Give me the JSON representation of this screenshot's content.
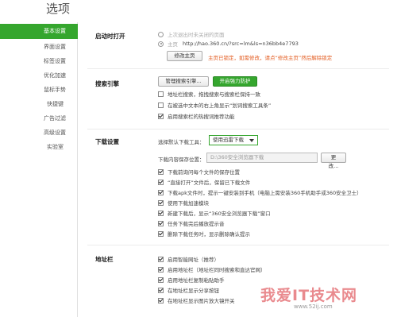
{
  "page": {
    "title": "选项"
  },
  "sidebar": {
    "items": [
      {
        "label": "基本设置",
        "active": true
      },
      {
        "label": "界面设置"
      },
      {
        "label": "标签设置"
      },
      {
        "label": "优化加速"
      },
      {
        "label": "鼠标手势"
      },
      {
        "label": "快捷键"
      },
      {
        "label": "广告过滤"
      },
      {
        "label": "高级设置"
      },
      {
        "label": "实验室"
      }
    ]
  },
  "startup": {
    "label": "启动时打开",
    "option_last": "上次退出时未关闭的页面",
    "option_home_prefix": "主页",
    "home_url": "http://hao.360.cn/?src=lm&ls=n36bb4e7793",
    "modify_home_button": "修改主页",
    "locked_notice": "主页已锁定，如需修改，请点“修改主页”然后解除锁定"
  },
  "search": {
    "label": "搜索引擎",
    "manage_button": "管理搜索引擎...",
    "protect_button": "开启强力防护",
    "options": [
      {
        "label": "地址栏搜索，拖拽搜索与搜索栏保持一致",
        "checked": false
      },
      {
        "label": "在被选中文本的右上角显示“划词搜索工具条”",
        "checked": false
      },
      {
        "label": "启用搜索栏的热搜词推荐功能",
        "checked": true
      }
    ]
  },
  "download": {
    "label": "下载设置",
    "tool_label": "选择默认下载工具：",
    "tool_value": "使用迅雷下载",
    "path_label": "下载内容保存位置：",
    "path_value": "D:\\360安全浏览器下载",
    "change_button": "更改...",
    "options": [
      {
        "label": "下载前询问每个文件的保存位置",
        "checked": true
      },
      {
        "label": "“直接打开”文件后，保留已下载文件",
        "checked": true
      },
      {
        "label": "下载apk文件时，提示一键安装到手机（电脑上需安装360手机助手或360安全卫士）",
        "checked": true
      },
      {
        "label": "使用下载加速模块",
        "checked": true
      },
      {
        "label": "新建下载后，显示“360安全浏览器下载”窗口",
        "checked": true
      },
      {
        "label": "任务下载完后播放提示音",
        "checked": true
      },
      {
        "label": "删除下载任务时，显示删除确认提示",
        "checked": true
      }
    ]
  },
  "addressbar": {
    "label": "地址栏",
    "options": [
      {
        "label": "启用智能网址（推荐）",
        "checked": true
      },
      {
        "label": "启用地址栏（地址栏同时搜索和直达官网）",
        "checked": true
      },
      {
        "label": "启用地址栏复制粘贴助手",
        "checked": true
      },
      {
        "label": "在地址栏显示分享按钮",
        "checked": true
      },
      {
        "label": "在地址栏显示图片放大镜开关",
        "checked": true
      }
    ]
  },
  "watermark": {
    "text": "我爱IT技术网",
    "sub": "www.52ij.com"
  }
}
